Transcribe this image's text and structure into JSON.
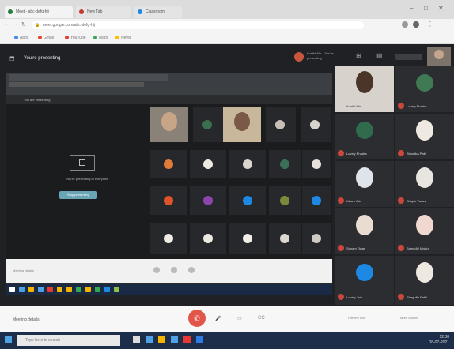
{
  "browser": {
    "tabs": [
      {
        "label": "Meet - abc-defg-hij",
        "color": "#2a7d3c"
      },
      {
        "label": "New Tab",
        "color": "#c0392b"
      },
      {
        "label": "Classroom",
        "color": "#1e88e5"
      }
    ],
    "url": "meet.google.com/abc-defg-hij",
    "bookmarks": [
      "Apps",
      "Gmail",
      "YouTube",
      "Maps",
      "News"
    ]
  },
  "meeting": {
    "presenting_title": "You're presenting",
    "presenter_note": "Kunthi Ma... You're presenting",
    "shared_title": "You are presenting",
    "present_label": "You're presenting to everyone",
    "stop_label": "Stop presenting",
    "inner_bottom": "Meeting details",
    "meeting_details": "Meeting details",
    "controls": {
      "hangup_glyph": "✆",
      "mic_glyph": "🎤",
      "cam_glyph": "▭",
      "cc_glyph": "CC",
      "present_label": "Present now",
      "more_label": "More options"
    }
  },
  "participants": [
    {
      "name": "Kunthi Ma",
      "mic": "muted"
    },
    {
      "name": "Lovely Bhadra",
      "mic": "muted"
    },
    {
      "name": "Lovely Bhadra",
      "mic": "muted"
    },
    {
      "name": "Bhumika Patil",
      "mic": "muted"
    },
    {
      "name": "Uttam Jain",
      "mic": "muted"
    },
    {
      "name": "Shapik Yadav",
      "mic": "muted"
    },
    {
      "name": "Sonam Tiwari",
      "mic": "muted"
    },
    {
      "name": "Samridhi Mishra",
      "mic": "muted"
    },
    {
      "name": "Lovely Jain",
      "mic": "muted"
    },
    {
      "name": "Shagufta Pathi",
      "mic": "muted"
    }
  ],
  "taskbar": {
    "search_placeholder": "Type here to search",
    "time": "12:30",
    "date": "08-07-2021"
  },
  "colors": {
    "accent": "#1a73e8",
    "danger": "#e2564a",
    "stage": "#202124"
  }
}
